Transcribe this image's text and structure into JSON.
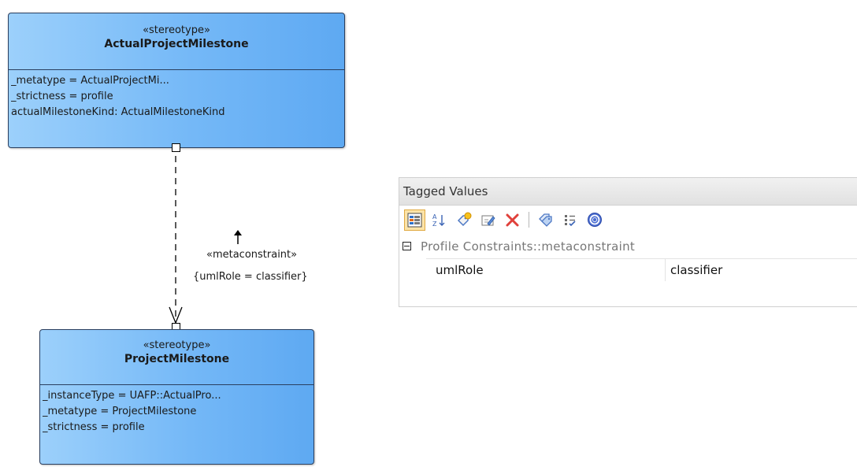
{
  "diagram": {
    "class_actual": {
      "stereotype": "«stereotype»",
      "name": "ActualProjectMilestone",
      "attributes": [
        "_metatype = ActualProjectMi...",
        "_strictness = profile",
        "actualMilestoneKind: ActualMilestoneKind"
      ]
    },
    "class_project": {
      "stereotype": "«stereotype»",
      "name": "ProjectMilestone",
      "attributes": [
        "_instanceType = UAFP::ActualPro...",
        "_metatype = ProjectMilestone",
        "_strictness = profile"
      ]
    },
    "connector": {
      "stereotype": "«metaconstraint»",
      "constraint": "{umlRole = classifier}"
    }
  },
  "tagged_values": {
    "title": "Tagged Values",
    "toolbar": [
      {
        "icon": "categorized-view-icon",
        "active": true
      },
      {
        "icon": "sort-alpha-icon"
      },
      {
        "icon": "new-tag-icon"
      },
      {
        "icon": "edit-tag-icon"
      },
      {
        "icon": "delete-icon"
      },
      {
        "icon": "tags-icon"
      },
      {
        "icon": "checklist-icon"
      },
      {
        "icon": "help-icon"
      }
    ],
    "group": {
      "label": "Profile Constraints::metaconstraint",
      "rows": [
        {
          "name": "umlRole",
          "value": "classifier"
        }
      ]
    }
  },
  "colors": {
    "class_fill_light": "#9cd0fb",
    "class_fill_dark": "#5ea9f2",
    "class_border": "#2a3f5f",
    "toolbar_active_bg": "#fbe3a8"
  }
}
